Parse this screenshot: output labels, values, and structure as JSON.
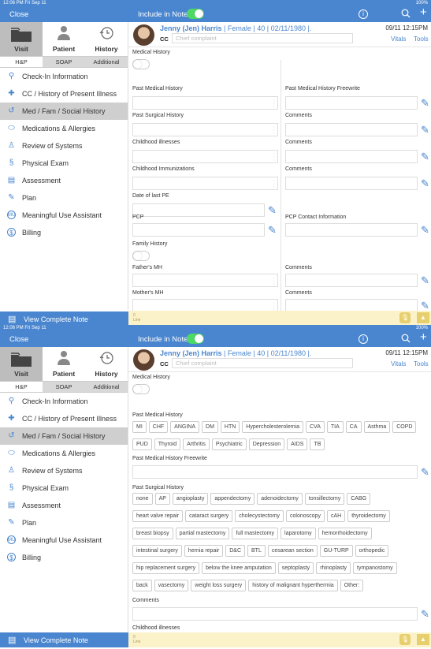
{
  "status": {
    "time": "12:06 PM  Fri Sep 11",
    "time2": "12:06 PM  Fri Sep 11",
    "battery": "100%"
  },
  "topbar": {
    "close": "Close",
    "include": "Include in Note"
  },
  "sidebar": {
    "top_tabs": [
      {
        "label": "Visit"
      },
      {
        "label": "Patient"
      },
      {
        "label": "History"
      }
    ],
    "sub_tabs": [
      {
        "label": "H&P"
      },
      {
        "label": "SOAP"
      },
      {
        "label": "Additional"
      }
    ],
    "items": [
      {
        "label": "Check-In Information"
      },
      {
        "label": "CC / History of Present Illness"
      },
      {
        "label": "Med / Fam / Social History"
      },
      {
        "label": "Medications & Allergies"
      },
      {
        "label": "Review of Systems"
      },
      {
        "label": "Physical Exam"
      },
      {
        "label": "Assessment"
      },
      {
        "label": "Plan"
      },
      {
        "label": "Meaningful Use Assistant"
      },
      {
        "label": "Billing"
      }
    ],
    "view_note": "View Complete Note"
  },
  "patient": {
    "name": "Jenny (Jen) Harris",
    "info": "| Female | 40 | 02/11/1980 |.",
    "datetime": "09/11 12:15PM",
    "cc_label": "CC",
    "cc_placeholder": "Chief complaint",
    "vitals": "Vitals",
    "tools": "Tools"
  },
  "form1": {
    "medical_history": "Medical History",
    "pmh": "Past Medical History",
    "pmh_free": "Past Medical History Freewrite",
    "psh": "Past Surgical History",
    "comments": "Comments",
    "childhood_illnesses": "Childhood illnesses",
    "childhood_imm": "Childhood Immunizations",
    "date_pe": "Date of last PE",
    "pcp": "PCP",
    "pcp_contact": "PCP Contact Information",
    "family_history": "Family History",
    "fathers_mh": "Father's MH",
    "mothers_mh": "Mother's MH"
  },
  "form2": {
    "medical_history": "Medical History",
    "pmh": "Past Medical History",
    "pmh_chips_row1": [
      "MI",
      "CHF",
      "ANGINA",
      "DM",
      "HTN",
      "Hypercholesterolemia",
      "CVA",
      "TIA",
      "CA",
      "Asthma",
      "COPD"
    ],
    "pmh_chips_row2": [
      "PUD",
      "Thyroid",
      "Arthritis",
      "Psychiatric",
      "Depression",
      "AIDS",
      "TB"
    ],
    "pmh_free": "Past Medical History Freewrite",
    "psh": "Past Surgical History",
    "psh_rows": [
      [
        "none",
        "AP",
        "angioplasty",
        "appendectomy",
        "adenoidectomy",
        "tonsillectomy",
        "CABG"
      ],
      [
        "heart valve repair",
        "cataract surgery",
        "cholecystectomy",
        "colonoscopy",
        "cAH",
        "thyroidectomy"
      ],
      [
        "breast biopsy",
        "partial mastectomy",
        "full mastectomy",
        "laparotomy",
        "hemorrhoidectomy"
      ],
      [
        "intestinal surgery",
        "hernia repair",
        "D&C",
        "BTL",
        "cesarean section",
        "GU-TURP",
        "orthopedic"
      ],
      [
        "hip replacement surgery",
        "below the knee amputation",
        "septoplasty",
        "rhinoplasty",
        "tympanostomy"
      ],
      [
        "back",
        "vasectomy",
        "weight loss surgery",
        "history of malignant hyperthermia",
        "Other:"
      ]
    ],
    "comments": "Comments",
    "childhood_illnesses": "Childhood illnesses"
  },
  "bottom": {
    "tiny1": "0",
    "tiny2": "Line"
  },
  "colors": {
    "accent": "#4a86cf",
    "toggle_on": "#4cd964",
    "note_bar": "#fbf2c9"
  }
}
